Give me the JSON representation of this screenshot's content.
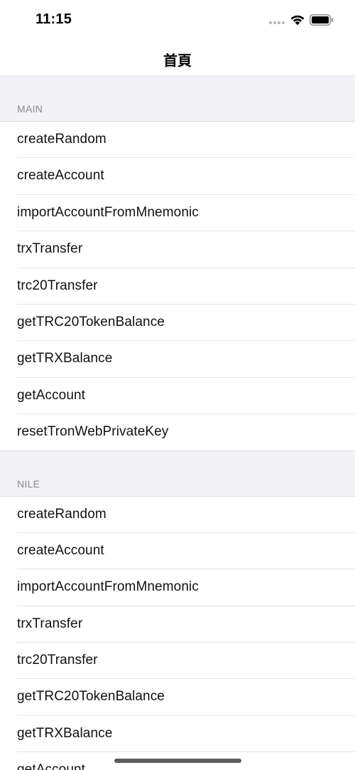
{
  "status_bar": {
    "time": "11:15",
    "icons": [
      "signal-dots-icon",
      "wifi-icon",
      "battery-icon"
    ]
  },
  "nav": {
    "title": "首頁"
  },
  "sections": [
    {
      "header": "MAIN",
      "items": [
        {
          "label": "createRandom"
        },
        {
          "label": "createAccount"
        },
        {
          "label": "importAccountFromMnemonic"
        },
        {
          "label": "trxTransfer"
        },
        {
          "label": "trc20Transfer"
        },
        {
          "label": "getTRC20TokenBalance"
        },
        {
          "label": "getTRXBalance"
        },
        {
          "label": "getAccount"
        },
        {
          "label": "resetTronWebPrivateKey"
        }
      ]
    },
    {
      "header": "NILE",
      "items": [
        {
          "label": "createRandom"
        },
        {
          "label": "createAccount"
        },
        {
          "label": "importAccountFromMnemonic"
        },
        {
          "label": "trxTransfer"
        },
        {
          "label": "trc20Transfer"
        },
        {
          "label": "getTRC20TokenBalance"
        },
        {
          "label": "getTRXBalance"
        },
        {
          "label": "getAccount"
        }
      ]
    }
  ],
  "colors": {
    "grouped_background": "#f2f2f7",
    "section_header_text": "#86868b",
    "separator": "#e4e4e7"
  }
}
